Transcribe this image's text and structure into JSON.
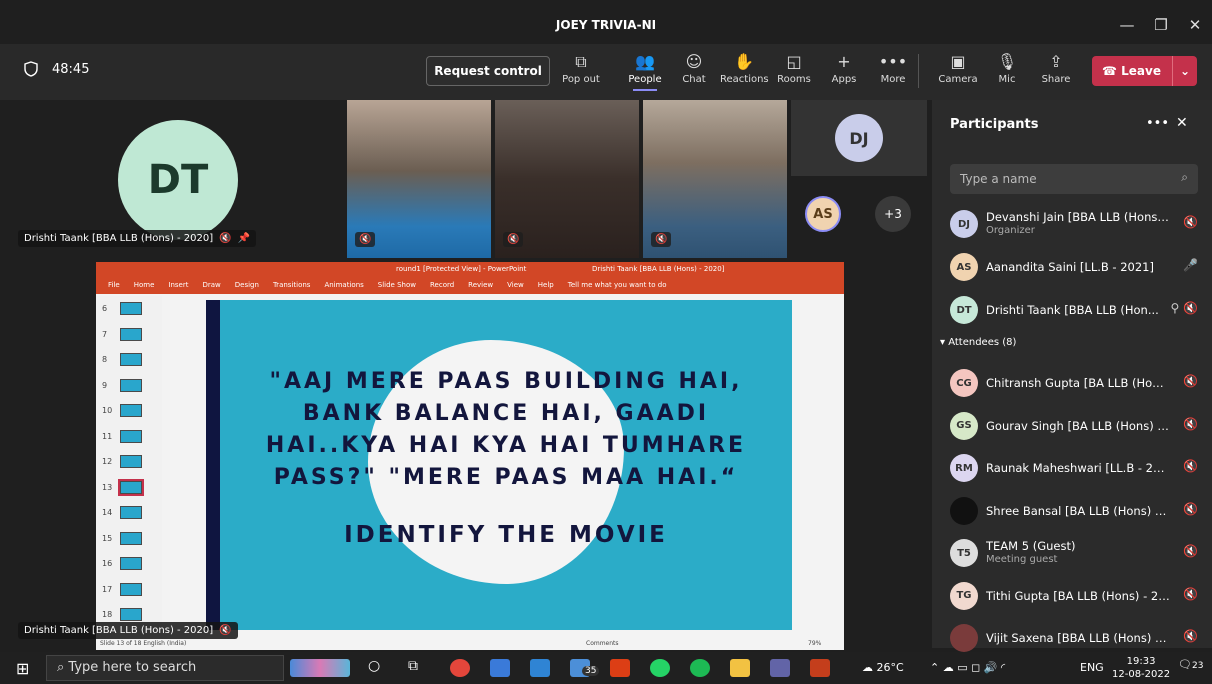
{
  "window": {
    "title": "JOEY TRIVIA-NI",
    "min": "—",
    "max": "❐",
    "close": "✕"
  },
  "meeting": {
    "timer": "48:45",
    "request_control": "Request control"
  },
  "toolbar": [
    {
      "label": "Pop out",
      "icon": "pop-out-icon"
    },
    {
      "label": "People",
      "icon": "people-icon",
      "active": true
    },
    {
      "label": "Chat",
      "icon": "chat-icon"
    },
    {
      "label": "Reactions",
      "icon": "reactions-icon"
    },
    {
      "label": "Rooms",
      "icon": "rooms-icon"
    },
    {
      "label": "Apps",
      "icon": "plus-icon"
    },
    {
      "label": "More",
      "icon": "more-icon"
    },
    {
      "label": "Camera",
      "icon": "camera-off-icon"
    },
    {
      "label": "Mic",
      "icon": "mic-off-icon"
    },
    {
      "label": "Share",
      "icon": "share-icon"
    }
  ],
  "leave": {
    "label": "Leave"
  },
  "stage": {
    "main_avatar": "DT",
    "main_name": "Drishti Taank [BBA LLB (Hons) - 2020]",
    "dj_avatar": "DJ",
    "as_avatar": "AS",
    "overflow": "+3",
    "share_name": "Drishti Taank [BBA LLB (Hons) - 2020]"
  },
  "ppt": {
    "title": "round1 [Protected View] - PowerPoint",
    "user": "Drishti Taank [BBA LLB (Hons) - 2020]",
    "menu": [
      "File",
      "Home",
      "Insert",
      "Draw",
      "Design",
      "Transitions",
      "Animations",
      "Slide Show",
      "Record",
      "Review",
      "View",
      "Help",
      "Tell me what you want to do"
    ],
    "thumbs": [
      "6",
      "7",
      "8",
      "9",
      "10",
      "11",
      "12",
      "13",
      "14",
      "15",
      "16",
      "17",
      "18"
    ],
    "selected_thumb": "13",
    "quote": "\"AAJ MERE PAAS BUILDING HAI, BANK BALANCE HAI, GAADI HAI..KYA HAI KYA HAI TUMHARE PASS?\" \"MERE PAAS MAA HAI.“",
    "identify": "IDENTIFY THE MOVIE",
    "status_left": "Slide 13 of 18   English (India)",
    "status_right": "Comments",
    "zoom": "79%",
    "colors": {
      "ribbon": "#d24726",
      "slide_bg": "#2bacc8",
      "text": "#13163d"
    }
  },
  "participants": {
    "title": "Participants",
    "search_placeholder": "Type a name",
    "attendees_label": "Attendees (8)",
    "presenters": [
      {
        "initials": "DJ",
        "name": "Devanshi Jain [BBA LLB (Hons) - ...",
        "sub": "Organizer",
        "color": "#c9cdea"
      },
      {
        "initials": "AS",
        "name": "Aanandita Saini [LL.B - 2021]",
        "sub": "",
        "color": "#f0d3b0"
      },
      {
        "initials": "DT",
        "name": "Drishti Taank [BBA LLB (Hon...",
        "sub": "",
        "color": "#c6e8d8"
      }
    ],
    "attendees": [
      {
        "initials": "CG",
        "name": "Chitransh Gupta [BA LLB (Hons) ...",
        "sub": "",
        "color": "#f4c6c0"
      },
      {
        "initials": "GS",
        "name": "Gourav Singh [BA LLB (Hons) - 2...",
        "sub": "",
        "color": "#d6e8c8"
      },
      {
        "initials": "RM",
        "name": "Raunak Maheshwari [LL.B - 2021]",
        "sub": "",
        "color": "#dcd6f0"
      },
      {
        "initials": "",
        "name": "Shree Bansal [BA LLB (Hons) - 2...",
        "sub": "",
        "color": "#111111"
      },
      {
        "initials": "T5",
        "name": "TEAM 5 (Guest)",
        "sub": "Meeting guest",
        "color": "#dddddd"
      },
      {
        "initials": "TG",
        "name": "Tithi Gupta [BA LLB (Hons) - 2021]",
        "sub": "",
        "color": "#f1d9cf"
      },
      {
        "initials": "",
        "name": "Vijit Saxena [BBA LLB (Hons) - 2...",
        "sub": "",
        "color": "#7a3b3b"
      }
    ]
  },
  "taskbar": {
    "search_placeholder": "Type here to search",
    "badge": "35",
    "weather": "26°C",
    "lang": "ENG",
    "time": "19:33",
    "date": "12-08-2022",
    "notifications": "23"
  }
}
